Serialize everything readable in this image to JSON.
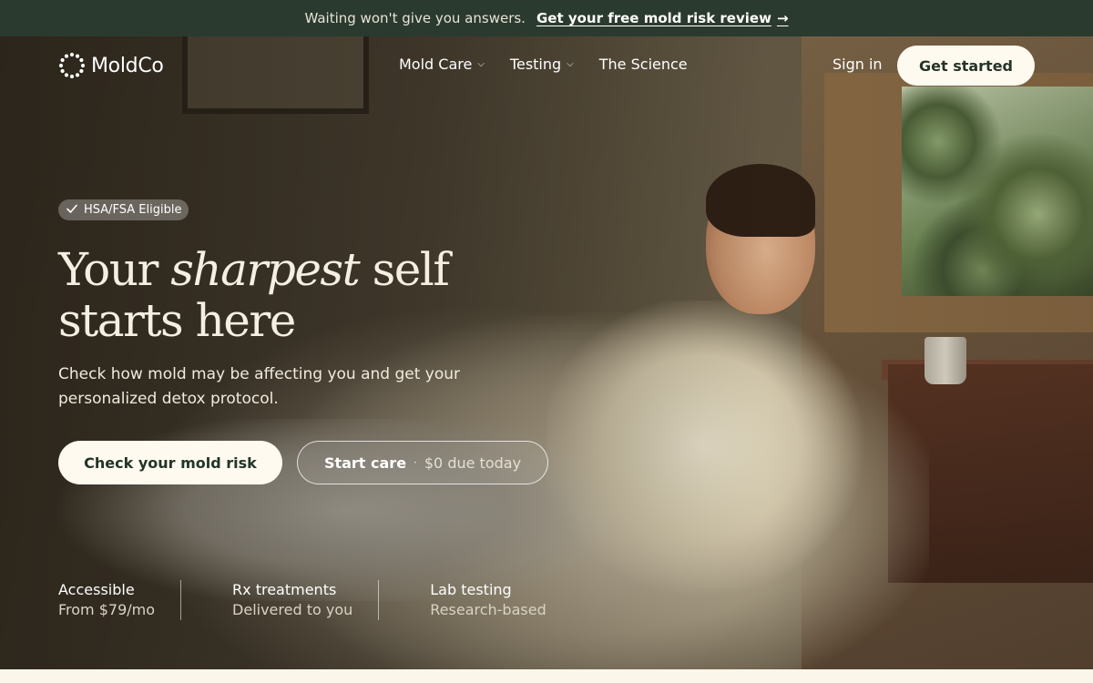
{
  "announcement": {
    "text": "Waiting won't give you answers.",
    "link_label": "Get your free mold risk review",
    "arrow": "→"
  },
  "nav": {
    "logo": "MoldCo",
    "links": [
      {
        "label": "Mold Care",
        "dropdown": true
      },
      {
        "label": "Testing",
        "dropdown": true
      },
      {
        "label": "The Science",
        "dropdown": false
      }
    ],
    "sign_in": "Sign in",
    "cta": "Get started"
  },
  "hero": {
    "badge": "HSA/FSA Eligible",
    "headline_part1": "Your ",
    "headline_italic": "sharpest",
    "headline_part2": " self",
    "headline_line2": "starts here",
    "subhead": "Check how mold may be affecting you and get your personalized detox protocol.",
    "primary_cta": "Check your mold risk",
    "secondary_cta_main": "Start care",
    "secondary_cta_separator": "·",
    "secondary_cta_sub": "$0 due today"
  },
  "features": [
    {
      "title": "Accessible",
      "detail": "From $79/mo"
    },
    {
      "title": "Rx treatments",
      "detail": "Delivered to you"
    },
    {
      "title": "Lab testing",
      "detail": "Research-based"
    }
  ],
  "colors": {
    "announce_bg": "#2b3a2e",
    "button_bg": "#fffaf0",
    "button_text": "#243428"
  },
  "icons": {
    "logo": "dotted-circle-icon",
    "chevron": "chevron-down-icon",
    "check": "check-icon",
    "arrow": "arrow-right-icon"
  }
}
